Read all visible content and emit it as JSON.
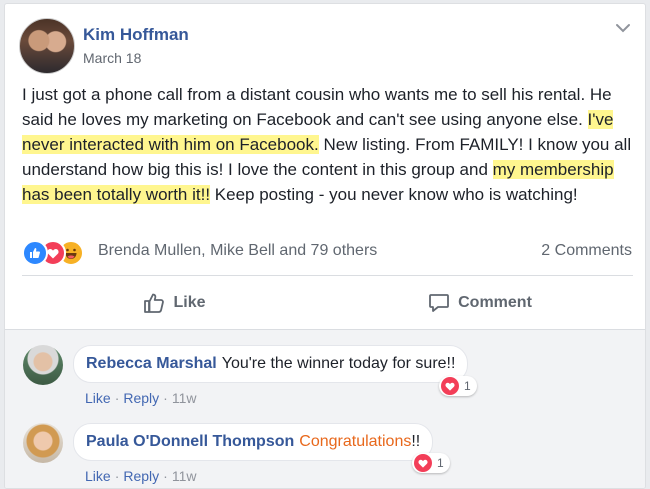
{
  "post": {
    "author": "Kim Hoffman",
    "date": "March 18",
    "text_segments": {
      "s1": "I just got a phone call from a distant cousin who wants me to sell his rental. He said he loves my marketing on Facebook and can't see using anyone else. ",
      "h1": "I've never interacted with him on Facebook.",
      "s2": " New listing. From FAMILY! I know you all understand how big this is! I love the content in this group and ",
      "h2": "my membership has been totally worth it!!",
      "s3": " Keep posting - you never know who is watching!"
    },
    "reactions": {
      "icons": [
        "like-icon",
        "love-icon",
        "haha-icon"
      ],
      "summary": "Brenda Mullen, Mike Bell and 79 others",
      "comments_count": "2 Comments"
    },
    "actions": {
      "like_label": "Like",
      "comment_label": "Comment"
    }
  },
  "comments": [
    {
      "name": "Rebecca Marshal",
      "text": "You're the winner today for sure!!",
      "like_label": "Like",
      "reply_label": "Reply",
      "time": "11w",
      "reaction_count": "1"
    },
    {
      "name": "Paula O'Donnell Thompson",
      "text_highlight": "Congratulations",
      "text_suffix": "!!",
      "like_label": "Like",
      "reply_label": "Reply",
      "time": "11w",
      "reaction_count": "1"
    }
  ],
  "colors": {
    "link_blue": "#365899",
    "highlight": "#fff68f",
    "love_red": "#f33e58",
    "like_blue": "#2d88ff",
    "congrats_orange": "#e8681c"
  }
}
